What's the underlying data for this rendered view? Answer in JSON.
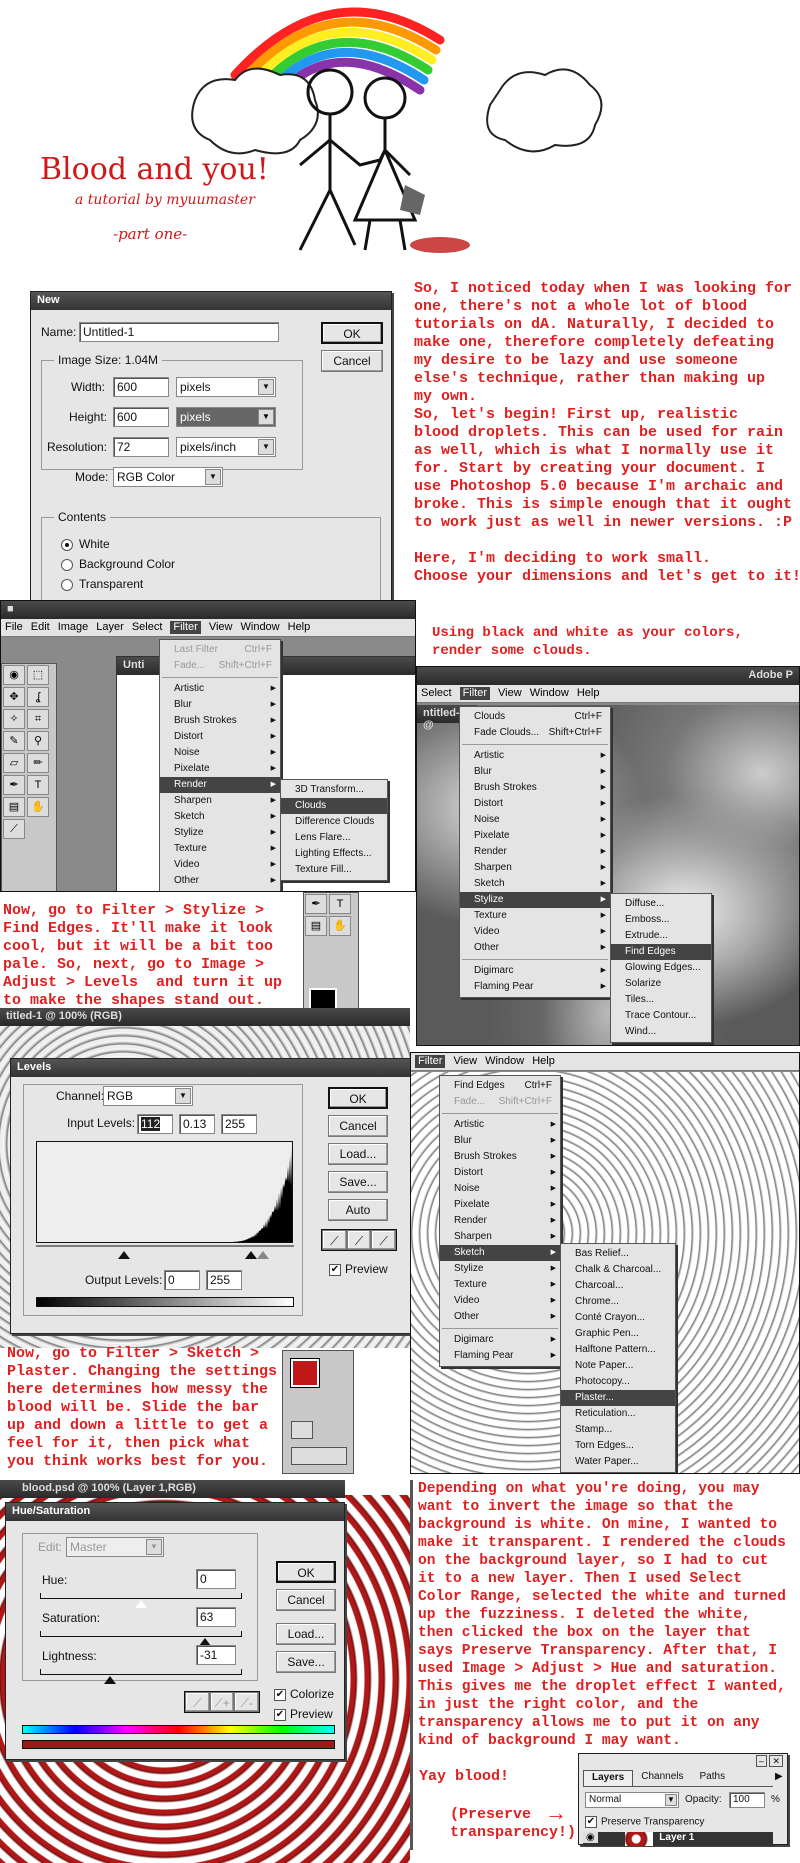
{
  "header": {
    "title": "Blood and you!",
    "subtitle": "a tutorial by myuumaster",
    "part": "-part one-"
  },
  "colors": {
    "text": "#e02020",
    "blood": "#9a1a1a"
  },
  "new_dialog": {
    "title": "New",
    "name_label": "Name:",
    "name_value": "Untitled-1",
    "ok": "OK",
    "cancel": "Cancel",
    "image_size": "Image Size: 1.04M",
    "width_label": "Width:",
    "width_value": "600",
    "width_unit": "pixels",
    "height_label": "Height:",
    "height_value": "600",
    "height_unit": "pixels",
    "resolution_label": "Resolution:",
    "resolution_value": "72",
    "resolution_unit": "pixels/inch",
    "mode_label": "Mode:",
    "mode_value": "RGB Color",
    "contents_label": "Contents",
    "contents": [
      {
        "label": "White",
        "checked": true
      },
      {
        "label": "Background Color",
        "checked": false
      },
      {
        "label": "Transparent",
        "checked": false
      }
    ]
  },
  "text1": "So, I noticed today when I was looking for\none, there's not a whole lot of blood\ntutorials on dA. Naturally, I decided to\nmake one, therefore completely defeating\nmy desire to be lazy and use someone\nelse's technique, rather than making up\nmy own.\nSo, let's begin! First up, realistic\nblood droplets. This can be used for rain\nas well, which is what I normally use it\nfor. Start by creating your document. I\nuse Photoshop 5.0 because I'm archaic and\nbroke. This is simple enough that it ought\nto work just as well in newer versions. :P\n\nHere, I'm deciding to work small.\nChoose your dimensions and let's get to it!",
  "text2": "Using black and white as your colors,\nrender some clouds.",
  "text3": "Now, go to Filter > Stylize >\nFind Edges. It'll make it look\ncool, but it will be a bit too\npale. So, next, go to Image >\nAdjust > Levels  and turn it up\nto make the shapes stand out.",
  "text4": "Now, go to Filter > Sketch >\nPlaster. Changing the settings\nhere determines how messy the\nblood will be. Slide the bar\nup and down a little to get a\nfeel for it, then pick what\nyou think works best for you.",
  "text5": "Depending on what you're doing, you may\nwant to invert the image so that the\nbackground is white. On mine, I wanted to\nmake it transparent. I rendered the clouds\non the background layer, so I had to cut\nit to a new layer. Then I used Select\nColor Range, selected the white and turned\nup the fuzziness. I deleted the white,\nthen clicked the box on the layer that\nsays Preserve Transparency. After that, I\nused Image > Adjust > Hue and saturation.\nThis gives me the droplet effect I wanted,\nin just the right color, and the\ntransparency allows me to put it on any\nkind of background I may want.",
  "yay": "Yay blood!",
  "preserve_note": "(Preserve\ntransparency!)",
  "ps1": {
    "menubar": [
      "File",
      "Edit",
      "Image",
      "Layer",
      "Select",
      "Filter",
      "View",
      "Window",
      "Help"
    ],
    "active": "Filter",
    "doc_title": "Unti",
    "menu": [
      {
        "l": "Last Filter",
        "s": "Ctrl+F",
        "d": 1
      },
      {
        "l": "Fade...",
        "s": "Shift+Ctrl+F",
        "d": 1
      },
      {
        "sep": 1
      },
      {
        "l": "Artistic",
        "sub": 1
      },
      {
        "l": "Blur",
        "sub": 1
      },
      {
        "l": "Brush Strokes",
        "sub": 1
      },
      {
        "l": "Distort",
        "sub": 1
      },
      {
        "l": "Noise",
        "sub": 1
      },
      {
        "l": "Pixelate",
        "sub": 1
      },
      {
        "l": "Render",
        "sub": 1,
        "hl": 1
      },
      {
        "l": "Sharpen",
        "sub": 1
      },
      {
        "l": "Sketch",
        "sub": 1
      },
      {
        "l": "Stylize",
        "sub": 1
      },
      {
        "l": "Texture",
        "sub": 1
      },
      {
        "l": "Video",
        "sub": 1
      },
      {
        "l": "Other",
        "sub": 1
      }
    ],
    "submenu": [
      {
        "l": "3D Transform..."
      },
      {
        "l": "Clouds",
        "hl": 1
      },
      {
        "l": "Difference Clouds"
      },
      {
        "l": "Lens Flare..."
      },
      {
        "l": "Lighting Effects..."
      },
      {
        "l": "Texture Fill..."
      }
    ]
  },
  "ps2": {
    "app_title": "Adobe P",
    "doc_title": "ntitled-1 @",
    "menubar": [
      "Select",
      "Filter",
      "View",
      "Window",
      "Help"
    ],
    "active": "Filter",
    "menu": [
      {
        "l": "Clouds",
        "s": "Ctrl+F"
      },
      {
        "l": "Fade Clouds...",
        "s": "Shift+Ctrl+F"
      },
      {
        "sep": 1
      },
      {
        "l": "Artistic",
        "sub": 1
      },
      {
        "l": "Blur",
        "sub": 1
      },
      {
        "l": "Brush Strokes",
        "sub": 1
      },
      {
        "l": "Distort",
        "sub": 1
      },
      {
        "l": "Noise",
        "sub": 1
      },
      {
        "l": "Pixelate",
        "sub": 1
      },
      {
        "l": "Render",
        "sub": 1
      },
      {
        "l": "Sharpen",
        "sub": 1
      },
      {
        "l": "Sketch",
        "sub": 1
      },
      {
        "l": "Stylize",
        "sub": 1,
        "hl": 1
      },
      {
        "l": "Texture",
        "sub": 1
      },
      {
        "l": "Video",
        "sub": 1
      },
      {
        "l": "Other",
        "sub": 1
      },
      {
        "sep": 1
      },
      {
        "l": "Digimarc",
        "sub": 1
      },
      {
        "l": "Flaming Pear",
        "sub": 1
      }
    ],
    "submenu": [
      {
        "l": "Diffuse..."
      },
      {
        "l": "Emboss..."
      },
      {
        "l": "Extrude..."
      },
      {
        "l": "Find Edges",
        "hl": 1
      },
      {
        "l": "Glowing Edges..."
      },
      {
        "l": "Solarize"
      },
      {
        "l": "Tiles..."
      },
      {
        "l": "Trace Contour..."
      },
      {
        "l": "Wind..."
      }
    ]
  },
  "doc_strip": "titled-1 @ 100% (RGB)",
  "levels": {
    "title": "Levels",
    "channel_label": "Channel:",
    "channel": "RGB",
    "input_label": "Input Levels:",
    "input": [
      "112",
      "0.13",
      "255"
    ],
    "output_label": "Output Levels:",
    "output": [
      "0",
      "255"
    ],
    "ok": "OK",
    "cancel": "Cancel",
    "load": "Load...",
    "save": "Save...",
    "auto": "Auto",
    "preview": "Preview"
  },
  "ps3": {
    "menubar": [
      "Filter",
      "View",
      "Window",
      "Help"
    ],
    "active": "Filter",
    "menu": [
      {
        "l": "Find Edges",
        "s": "Ctrl+F"
      },
      {
        "l": "Fade...",
        "s": "Shift+Ctrl+F",
        "d": 1
      },
      {
        "sep": 1
      },
      {
        "l": "Artistic",
        "sub": 1
      },
      {
        "l": "Blur",
        "sub": 1
      },
      {
        "l": "Brush Strokes",
        "sub": 1
      },
      {
        "l": "Distort",
        "sub": 1
      },
      {
        "l": "Noise",
        "sub": 1
      },
      {
        "l": "Pixelate",
        "sub": 1
      },
      {
        "l": "Render",
        "sub": 1
      },
      {
        "l": "Sharpen",
        "sub": 1
      },
      {
        "l": "Sketch",
        "sub": 1,
        "hl": 1
      },
      {
        "l": "Stylize",
        "sub": 1
      },
      {
        "l": "Texture",
        "sub": 1
      },
      {
        "l": "Video",
        "sub": 1
      },
      {
        "l": "Other",
        "sub": 1
      },
      {
        "sep": 1
      },
      {
        "l": "Digimarc",
        "sub": 1
      },
      {
        "l": "Flaming Pear",
        "sub": 1
      }
    ],
    "submenu": [
      {
        "l": "Bas Relief..."
      },
      {
        "l": "Chalk & Charcoal..."
      },
      {
        "l": "Charcoal..."
      },
      {
        "l": "Chrome..."
      },
      {
        "l": "Conté Crayon..."
      },
      {
        "l": "Graphic Pen..."
      },
      {
        "l": "Halftone Pattern..."
      },
      {
        "l": "Note Paper..."
      },
      {
        "l": "Photocopy..."
      },
      {
        "l": "Plaster...",
        "hl": 1
      },
      {
        "l": "Reticulation..."
      },
      {
        "l": "Stamp..."
      },
      {
        "l": "Torn Edges..."
      },
      {
        "l": "Water Paper..."
      }
    ]
  },
  "blood_doc": "blood.psd @ 100% (Layer 1,RGB)",
  "huesat": {
    "title": "Hue/Saturation",
    "edit_label": "Edit:",
    "edit": "Master",
    "hue_label": "Hue:",
    "hue": "0",
    "sat_label": "Saturation:",
    "sat": "63",
    "light_label": "Lightness:",
    "light": "-31",
    "ok": "OK",
    "cancel": "Cancel",
    "load": "Load...",
    "save": "Save...",
    "colorize": "Colorize",
    "preview": "Preview",
    "hue_value": 0,
    "saturation_value": 63,
    "lightness_value": -31
  },
  "layers": {
    "tabs": [
      "Layers",
      "Channels",
      "Paths"
    ],
    "blend": "Normal",
    "opacity_label": "Opacity:",
    "opacity": "100",
    "pct": "%",
    "preserve": "Preserve Transparency",
    "layer_name": "Layer 1"
  }
}
